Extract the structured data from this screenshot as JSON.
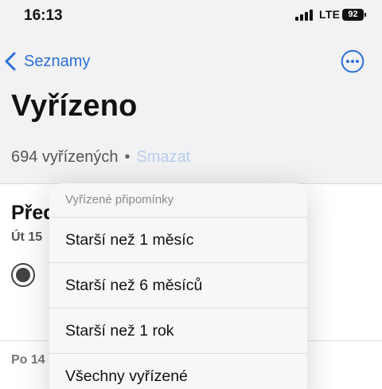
{
  "status_bar": {
    "time": "16:13",
    "network": "LTE",
    "battery": "92",
    "icons": [
      "signal-bars-icon",
      "battery-icon"
    ]
  },
  "nav": {
    "back_label": "Seznamy",
    "back_icon": "chevron-left-icon",
    "more_icon": "ellipsis-circle-icon"
  },
  "header": {
    "title": "Vyřízeno",
    "count_text": "694 vyřízených",
    "separator": "•",
    "clear_label": "Smazat"
  },
  "list": {
    "section_title": "Před",
    "section_date": "Út 15",
    "next_section_date": "Po 14"
  },
  "menu": {
    "header": "Vyřízené připomínky",
    "items": [
      {
        "label": "Starší než 1 měsíc"
      },
      {
        "label": "Starší než 6 měsíců"
      },
      {
        "label": "Starší než 1 rok"
      },
      {
        "label": "Všechny vyřízené"
      }
    ]
  },
  "colors": {
    "accent": "#2a6fd6",
    "clear_link_disabled": "#b9cdee",
    "text_primary": "#111111",
    "text_secondary": "#555555"
  }
}
